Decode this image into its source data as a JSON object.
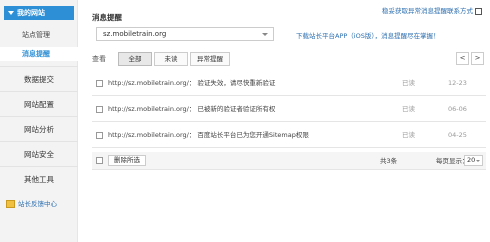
{
  "sidebar": {
    "header": "我的网站",
    "sub_items": [
      "站点管理",
      "消息提醒"
    ],
    "active_sub": 1,
    "items": [
      "数据提交",
      "网站配置",
      "网站分析",
      "网站安全",
      "其他工具"
    ],
    "help_link": "站长反馈中心"
  },
  "main": {
    "top_link": "稳妥获取异常消息提醒联系方式",
    "title": "消息提醒",
    "site_value": "sz.mobiletrain.org",
    "app_tip": "下载站长平台APP（iOS版），消息提醒尽在掌握！",
    "filter_label": "查看",
    "filters": [
      "全部",
      "未读",
      "异常提醒"
    ],
    "active_filter": 0,
    "prev": "<",
    "next": ">"
  },
  "messages": [
    {
      "text": "http://sz.mobiletrain.org/： 验证失效，请尽快重新验证",
      "state": "已读",
      "date": "12-23"
    },
    {
      "text": "http://sz.mobiletrain.org/： 已被新的验证者验证所有权",
      "state": "已读",
      "date": "06-06"
    },
    {
      "text": "http://sz.mobiletrain.org/： 百度站长平台已为您开通Sitemap权限",
      "state": "已读",
      "date": "04-25"
    }
  ],
  "footer": {
    "delete_label": "删除所选",
    "total": "共3条",
    "per_page_label": "每页显示：",
    "per_page_value": "20"
  }
}
